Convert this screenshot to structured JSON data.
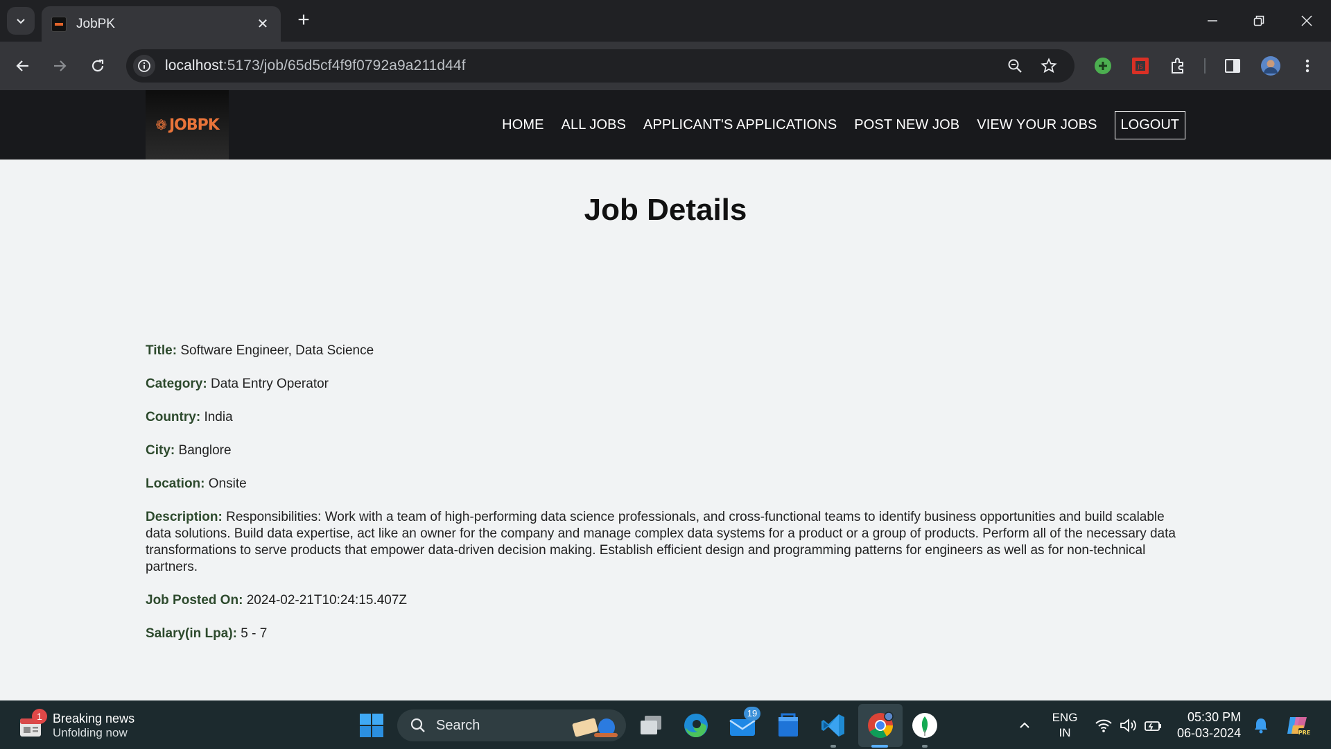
{
  "browser": {
    "tab_title": "JobPK",
    "url_host": "localhost",
    "url_path": ":5173/job/65d5cf4f9f0792a9a211d44f"
  },
  "site": {
    "logo_text": "JOBPK",
    "nav": {
      "home": "HOME",
      "all_jobs": "ALL JOBS",
      "applications": "APPLICANT'S APPLICATIONS",
      "post_job": "POST NEW JOB",
      "view_jobs": "VIEW YOUR JOBS",
      "logout": "LOGOUT"
    }
  },
  "page": {
    "title": "Job Details",
    "fields": {
      "title_label": "Title:",
      "title_value": "Software Engineer, Data Science",
      "category_label": "Category:",
      "category_value": "Data Entry Operator",
      "country_label": "Country:",
      "country_value": "India",
      "city_label": "City:",
      "city_value": "Banglore",
      "location_label": "Location:",
      "location_value": "Onsite",
      "description_label": "Description:",
      "description_value": "Responsibilities: Work with a team of high-performing data science professionals, and cross-functional teams to identify business opportunities and build scalable data solutions. Build data expertise, act like an owner for the company and manage complex data systems for a product or a group of products. Perform all of the necessary data transformations to serve products that empower data-driven decision making. Establish efficient design and programming patterns for engineers as well as for non-technical partners.",
      "posted_label": "Job Posted On:",
      "posted_value": "2024-02-21T10:24:15.407Z",
      "salary_label": "Salary(in Lpa):",
      "salary_value": "5 - 7"
    }
  },
  "taskbar": {
    "news_title": "Breaking news",
    "news_sub": "Unfolding now",
    "news_badge": "1",
    "search_label": "Search",
    "mail_badge": "19",
    "lang_top": "ENG",
    "lang_bottom": "IN",
    "time": "05:30 PM",
    "date": "06-03-2024"
  },
  "colors": {
    "nav_bg": "#18191c",
    "logo_accent": "#e9743a",
    "label_color": "#2d4a2d",
    "page_bg": "#f1f3f4"
  }
}
